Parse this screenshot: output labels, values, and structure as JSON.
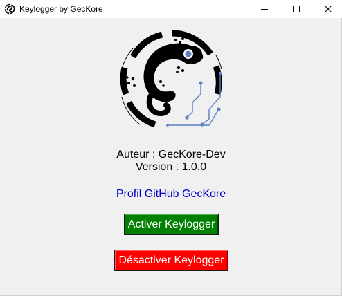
{
  "window": {
    "title": "Keylogger by GecKore",
    "icon": "gecko-icon",
    "controls": {
      "minimize_icon": "minimize-icon",
      "maximize_icon": "maximize-icon",
      "close_icon": "close-icon"
    }
  },
  "logo": {
    "icon": "gecko-circuit-logo",
    "colors": {
      "primary": "#000000",
      "accent": "#5b7fc4"
    }
  },
  "info": {
    "author": "Auteur : GecKore-Dev",
    "version": "Version : 1.0.0"
  },
  "link": {
    "label": "Profil GitHub GecKore",
    "color": "#0000cd"
  },
  "buttons": {
    "activate": {
      "label": "Activer Keylogger",
      "color": "#008000"
    },
    "deactivate": {
      "label": "Désactiver Keylogger",
      "color": "#ff0000"
    }
  }
}
